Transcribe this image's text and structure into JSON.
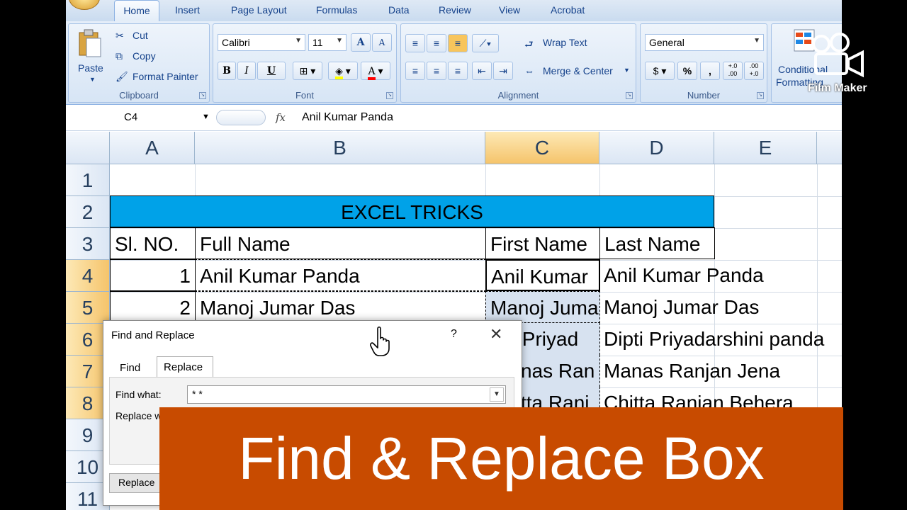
{
  "ribbon": {
    "tabs": [
      "Home",
      "Insert",
      "Page Layout",
      "Formulas",
      "Data",
      "Review",
      "View",
      "Acrobat"
    ],
    "clipboard": {
      "paste": "Paste",
      "cut": "Cut",
      "copy": "Copy",
      "format_painter": "Format Painter",
      "label": "Clipboard"
    },
    "font": {
      "name": "Calibri",
      "size": "11",
      "label": "Font",
      "bold": "B",
      "italic": "I",
      "underline": "U"
    },
    "alignment": {
      "wrap_text": "Wrap Text",
      "merge_center": "Merge & Center",
      "label": "Alignment"
    },
    "number": {
      "format": "General",
      "label": "Number",
      "percent": "%",
      "comma": ",",
      "inc_dec": "+.0 .00",
      "dec_dec": ".00 +.0"
    },
    "styles": {
      "conditional": "Conditional",
      "formatting": "Formatting"
    }
  },
  "formula_bar": {
    "name_box": "C4",
    "fx": "fx",
    "content": "Anil Kumar Panda"
  },
  "grid": {
    "columns": [
      "A",
      "B",
      "C",
      "D",
      "E"
    ],
    "rows": [
      "1",
      "2",
      "3",
      "4",
      "5",
      "6",
      "7",
      "8",
      "9",
      "10",
      "11"
    ],
    "title": "EXCEL TRICKS",
    "headers": {
      "sl": "Sl. NO.",
      "full": "Full Name",
      "first": "First Name",
      "last": "Last Name"
    },
    "data": [
      {
        "sl": "1",
        "full": "Anil Kumar Panda",
        "first": "Anil Kumar",
        "last": "Anil Kumar Panda"
      },
      {
        "sl": "2",
        "full": "Manoj Jumar Das",
        "first": "Manoj Jumar",
        "last": "Manoj Jumar Das"
      },
      {
        "first": "ti Priyad",
        "last": "Dipti Priyadarshini panda"
      },
      {
        "first": "nas Ran",
        "last": "Manas Ranjan Jena"
      },
      {
        "first": "tta Ranj",
        "last": "Chitta Ranjan Behera"
      }
    ]
  },
  "dialog": {
    "title": "Find and Replace",
    "help": "?",
    "close": "✕",
    "tab_find": "Find",
    "tab_replace": "Replace",
    "find_label": "Find what:",
    "find_value": "* *",
    "replace_label": "Replace w",
    "replace_button": "Replace"
  },
  "overlay": {
    "banner": "Find & Replace Box",
    "watermark": "Film Maker"
  }
}
